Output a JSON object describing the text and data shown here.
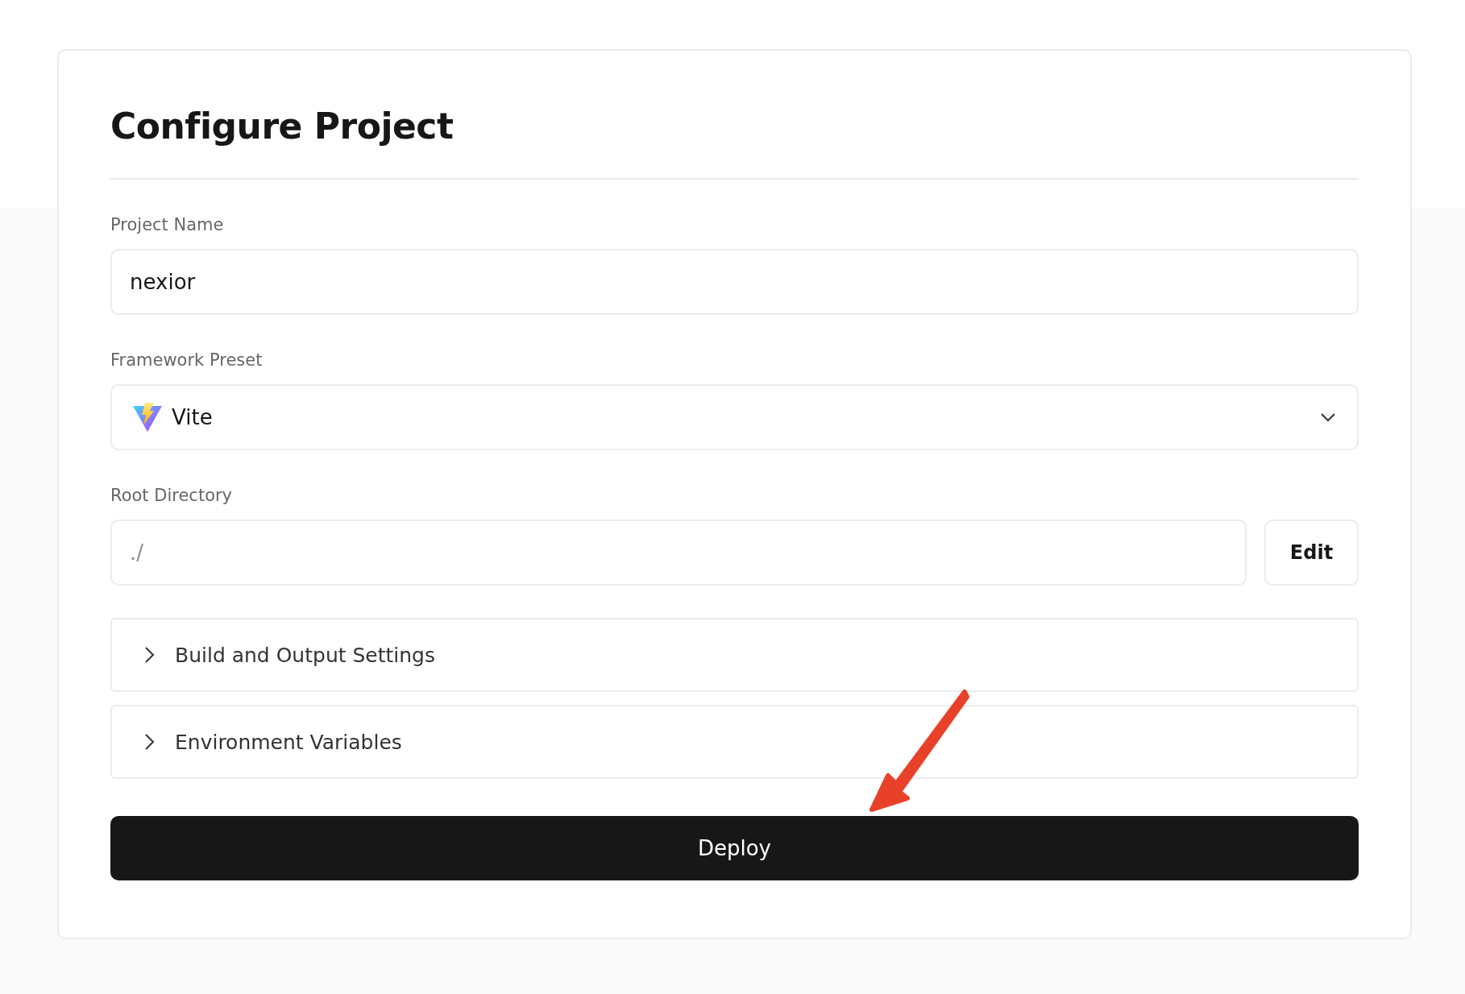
{
  "title": "Configure Project",
  "fields": [
    {
      "label": "Project Name",
      "kind": "text",
      "value": "nexior"
    },
    {
      "label": "Framework Preset",
      "kind": "select",
      "value": "Vite"
    },
    {
      "label": "Root Directory",
      "kind": "text-with-button",
      "placeholder": "./",
      "button": "Edit"
    }
  ],
  "sections": [
    {
      "label": "Build and Output Settings",
      "expanded": false
    },
    {
      "label": "Environment Variables",
      "expanded": false
    }
  ],
  "primary_button": "Deploy"
}
